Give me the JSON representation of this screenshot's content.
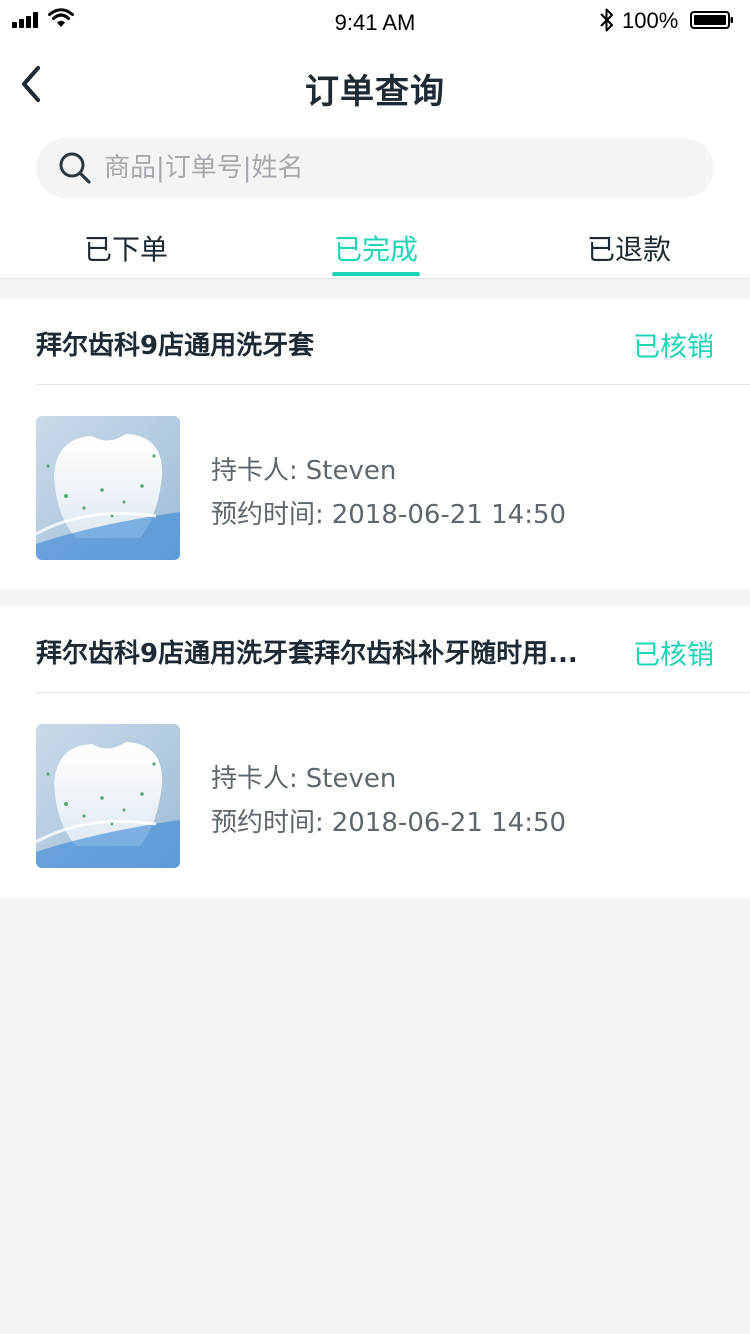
{
  "status_bar": {
    "time": "9:41 AM",
    "battery": "100%"
  },
  "nav": {
    "title": "订单查询"
  },
  "search": {
    "placeholder": "商品|订单号|姓名",
    "value": ""
  },
  "tabs": [
    {
      "label": "已下单",
      "active": false
    },
    {
      "label": "已完成",
      "active": true
    },
    {
      "label": "已退款",
      "active": false
    }
  ],
  "colors": {
    "accent": "#1fd5b8",
    "title_text": "#1e2a33",
    "secondary_text": "#5e666e",
    "page_background": "#f4f4f4"
  },
  "orders": [
    {
      "title": "拜尔齿科9店通用洗牙套",
      "status": "已核销",
      "holder_label": "持卡人:",
      "holder": "Steven",
      "time_label": "预约时间:",
      "time": "2018-06-21 14:50"
    },
    {
      "title": "拜尔齿科9店通用洗牙套拜尔齿科补牙随时用...",
      "status": "已核销",
      "holder_label": "持卡人:",
      "holder": "Steven",
      "time_label": "预约时间:",
      "time": "2018-06-21 14:50"
    }
  ]
}
